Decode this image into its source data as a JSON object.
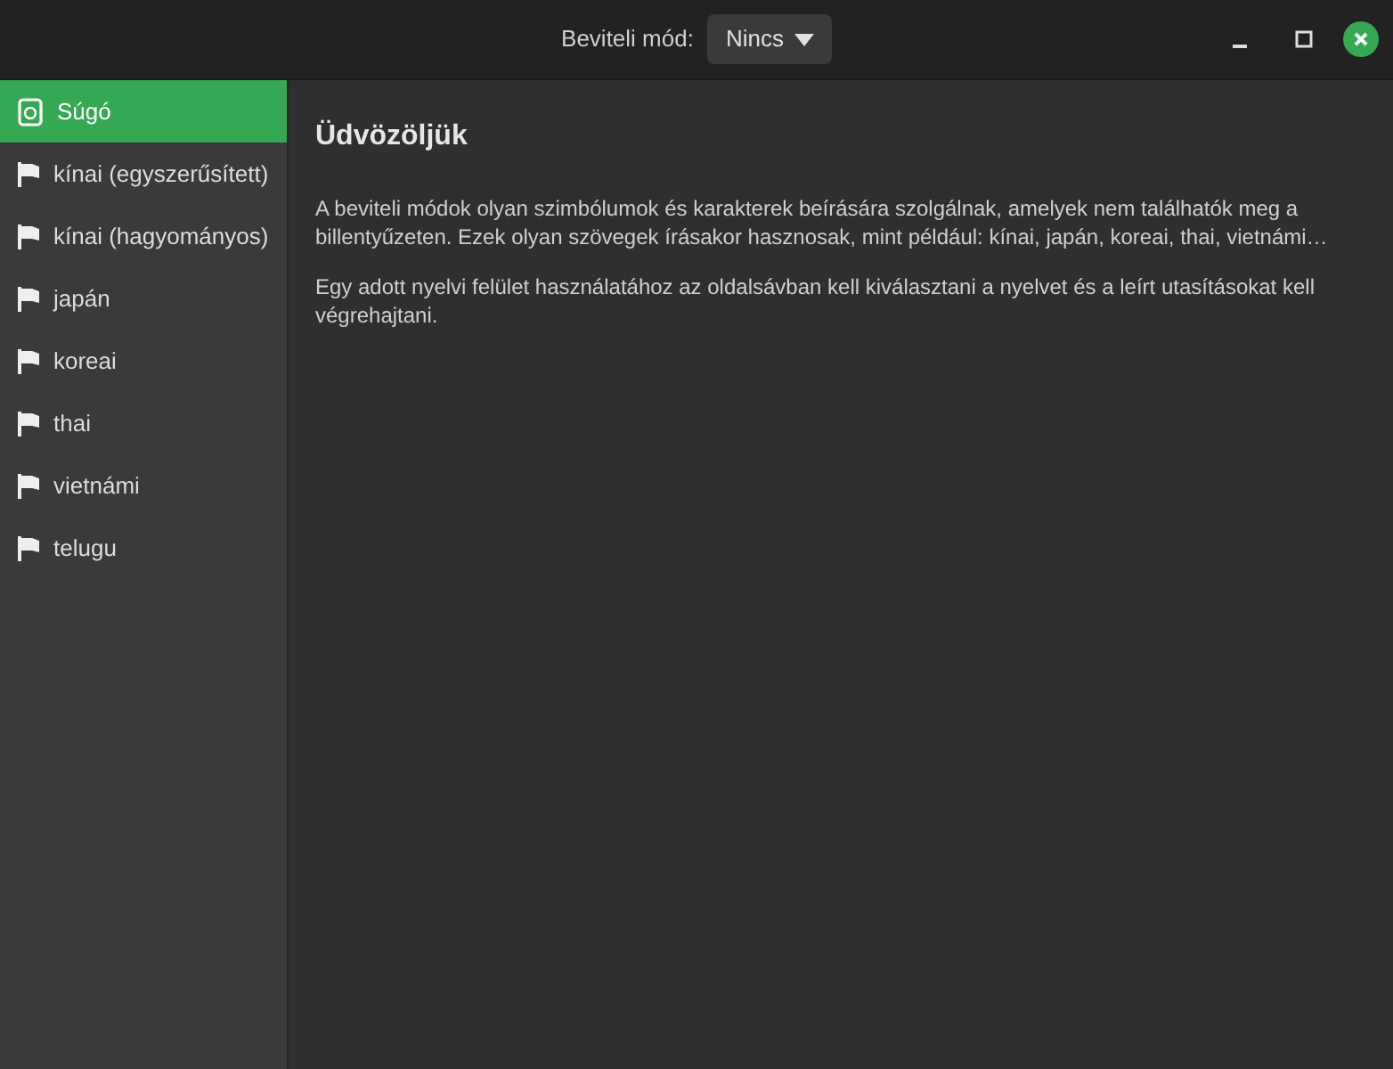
{
  "header": {
    "mode_label": "Beviteli mód:",
    "mode_value": "Nincs"
  },
  "sidebar": {
    "items": [
      {
        "label": "Súgó",
        "kind": "help",
        "selected": true
      },
      {
        "label": "kínai (egyszerűsített)",
        "kind": "language",
        "selected": false
      },
      {
        "label": "kínai (hagyományos)",
        "kind": "language",
        "selected": false
      },
      {
        "label": "japán",
        "kind": "language",
        "selected": false
      },
      {
        "label": "koreai",
        "kind": "language",
        "selected": false
      },
      {
        "label": "thai",
        "kind": "language",
        "selected": false
      },
      {
        "label": "vietnámi",
        "kind": "language",
        "selected": false
      },
      {
        "label": "telugu",
        "kind": "language",
        "selected": false
      }
    ]
  },
  "content": {
    "title": "Üdvözöljük",
    "paragraphs": [
      "A beviteli módok olyan szimbólumok és karakterek beírására szolgálnak, amelyek nem találhatók meg a billentyűzeten. Ezek olyan szövegek írásakor hasznosak, mint például: kínai, japán, koreai, thai, vietnámi…",
      "Egy adott nyelvi felület használatához az oldalsávban kell kiválasztani a nyelvet és a leírt utasításokat kell végrehajtani."
    ]
  }
}
